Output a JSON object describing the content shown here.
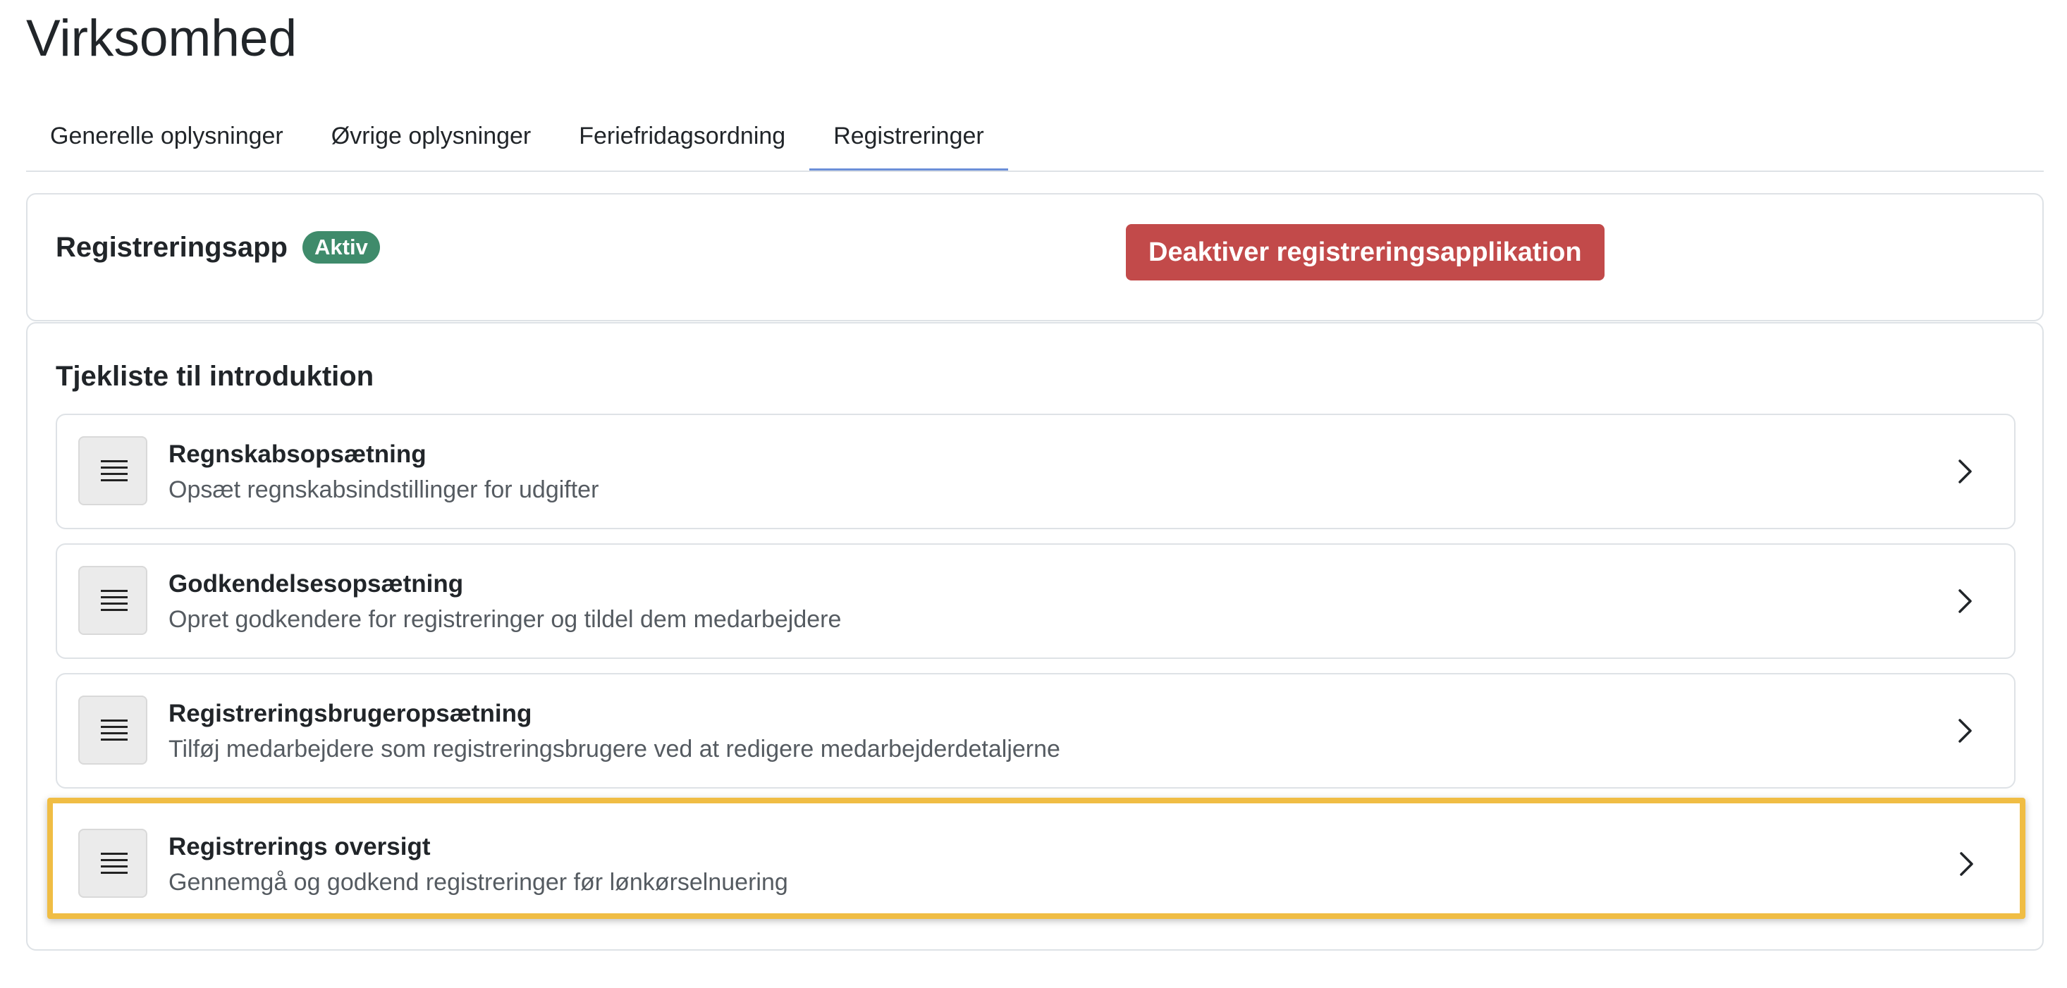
{
  "page": {
    "title": "Virksomhed"
  },
  "tabs": [
    {
      "label": "Generelle oplysninger",
      "active": false
    },
    {
      "label": "Øvrige oplysninger",
      "active": false
    },
    {
      "label": "Feriefridagsordning",
      "active": false
    },
    {
      "label": "Registreringer",
      "active": true
    }
  ],
  "app_card": {
    "title": "Registreringsapp",
    "status_badge": "Aktiv",
    "deactivate_button": "Deaktiver registreringsapplikation"
  },
  "checklist": {
    "title": "Tjekliste til introduktion",
    "items": [
      {
        "title": "Regnskabsopsætning",
        "subtitle": "Opsæt regnskabsindstillinger for udgifter",
        "icon": "list-icon",
        "highlighted": false
      },
      {
        "title": "Godkendelsesopsætning",
        "subtitle": "Opret godkendere for registreringer og tildel dem medarbejdere",
        "icon": "list-icon",
        "highlighted": false
      },
      {
        "title": "Registreringsbrugeropsætning",
        "subtitle": "Tilføj medarbejdere som registreringsbrugere ved at redigere medarbejderdetaljerne",
        "icon": "list-icon",
        "highlighted": false
      },
      {
        "title": "Registrerings oversigt",
        "subtitle": "Gennemgå og godkend registreringer før lønkørselnuering",
        "icon": "list-icon",
        "highlighted": true
      }
    ]
  },
  "colors": {
    "active_badge": "#3f8b6b",
    "danger_button": "#c24a4a",
    "tab_active_underline": "#6b8fd8",
    "highlight_border": "#f0bd44"
  }
}
